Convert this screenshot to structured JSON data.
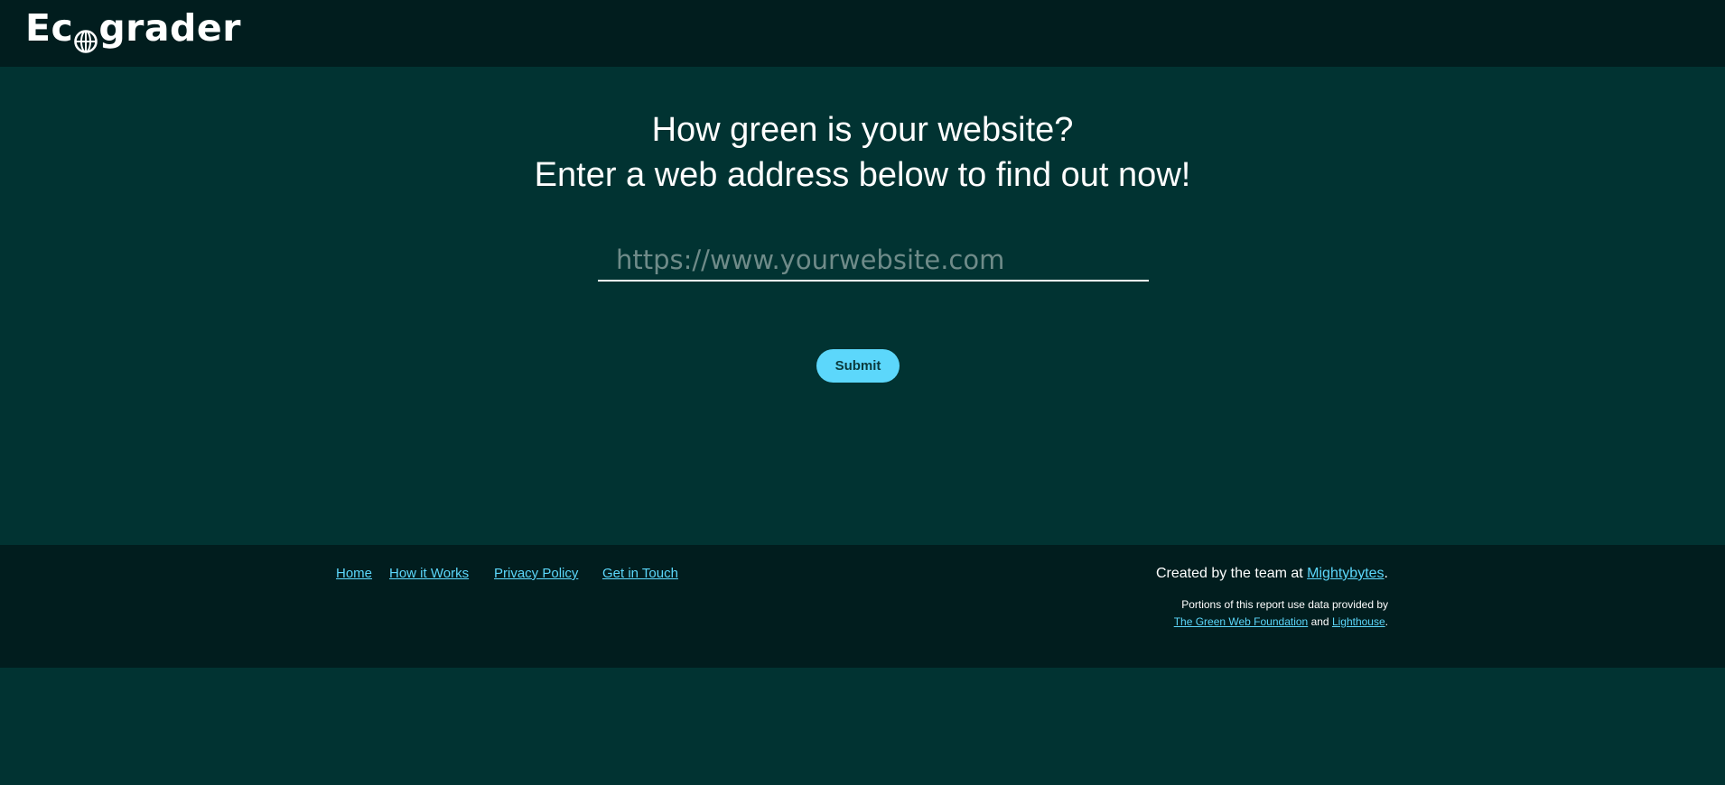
{
  "header": {
    "logo_prefix": "Ec",
    "logo_icon": "globe-icon",
    "logo_suffix": "grader"
  },
  "hero": {
    "headline_line1": "How green is your website?",
    "headline_line2": "Enter a web address below to find out now!",
    "url_input": {
      "placeholder": "https://www.yourwebsite.com",
      "value": ""
    },
    "submit_label": "Submit"
  },
  "footer": {
    "nav": [
      {
        "label": "Home"
      },
      {
        "label": "How it Works"
      },
      {
        "label": "Privacy Policy"
      },
      {
        "label": "Get in Touch"
      }
    ],
    "created_prefix": "Created by the team at ",
    "created_link": "Mightybytes",
    "created_suffix": ".",
    "portions_text": "Portions of this report use data provided by",
    "source_link_1": "The Green Web Foundation",
    "source_and": " and ",
    "source_link_2": "Lighthouse",
    "source_suffix": "."
  },
  "colors": {
    "background": "#013332",
    "header_footer": "#011d1e",
    "accent": "#5cd7fb",
    "text": "#ffffff"
  }
}
